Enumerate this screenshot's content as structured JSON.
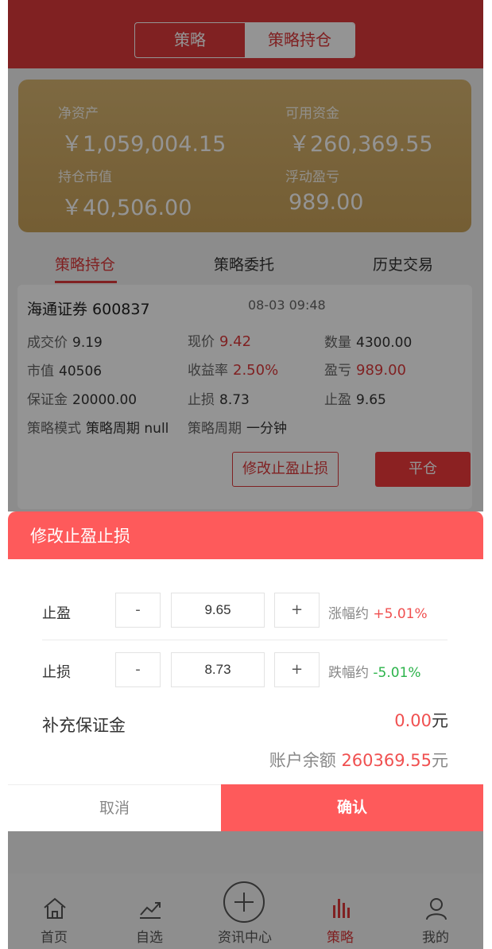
{
  "header": {
    "segments": [
      "策略",
      "策略持仓"
    ],
    "active_segment": 1
  },
  "assets": {
    "net_assets_label": "净资产",
    "net_assets_value": "￥1,059,004.15",
    "available_funds_label": "可用资金",
    "available_funds_value": "￥260,369.55",
    "position_value_label": "持仓市值",
    "position_value_value": "￥40,506.00",
    "floating_pnl_label": "浮动盈亏",
    "floating_pnl_value": "989.00"
  },
  "tabs": {
    "items": [
      "策略持仓",
      "策略委托",
      "历史交易"
    ],
    "active": 0
  },
  "position": {
    "name": "海通证券 600837",
    "time": "08-03 09:48",
    "deal_price_label": "成交价",
    "deal_price": "9.19",
    "current_price_label": "现价",
    "current_price": "9.42",
    "quantity_label": "数量",
    "quantity": "4300.00",
    "market_value_label": "市值",
    "market_value": "40506",
    "yield_label": "收益率",
    "yield": "2.50%",
    "pnl_label": "盈亏",
    "pnl": "989.00",
    "deposit_label": "保证金",
    "deposit": "20000.00",
    "stop_loss_label": "止损",
    "stop_loss": "8.73",
    "take_profit_label": "止盈",
    "take_profit": "9.65",
    "mode_label": "策略模式",
    "mode_value": "策略周期 null",
    "cycle_label": "策略周期",
    "cycle_value": "一分钟",
    "modify_button": "修改止盈止损",
    "close_button": "平仓"
  },
  "modal": {
    "title": "修改止盈止损",
    "take_profit_label": "止盈",
    "take_profit_value": "9.65",
    "take_profit_hint": "涨幅约",
    "take_profit_pct": "+5.01%",
    "stop_loss_label": "止损",
    "stop_loss_value": "8.73",
    "stop_loss_hint": "跌幅约",
    "stop_loss_pct": "-5.01%",
    "minus": "-",
    "plus": "+",
    "margin_label": "补充保证金",
    "margin_amount": "0.00",
    "currency_unit": "元",
    "balance_label": "账户余额",
    "balance_amount": "260369.55",
    "cancel": "取消",
    "confirm": "确认"
  },
  "nav": {
    "items": [
      "首页",
      "自选",
      "资讯中心",
      "策略",
      "我的"
    ],
    "active": 3
  },
  "colors": {
    "brand_red": "#dc3a3c",
    "modal_red": "#fe5a5b",
    "gold": "#d8b571",
    "up": "#f05050",
    "down": "#2bb34a"
  }
}
